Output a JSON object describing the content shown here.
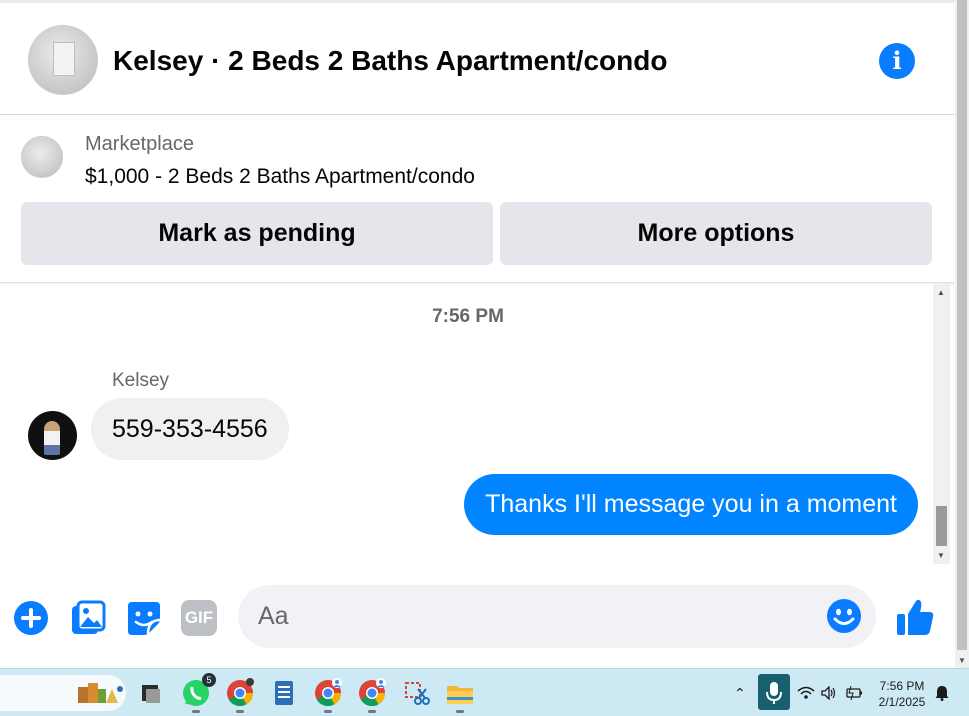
{
  "header": {
    "title": "Kelsey · 2 Beds 2 Baths Apartment/condo",
    "info_icon_glyph": "i"
  },
  "listing": {
    "source": "Marketplace",
    "name": "$1,000 - 2 Beds 2 Baths Apartment/condo",
    "primary_button": "Mark as pending",
    "secondary_button": "More options"
  },
  "conversation": {
    "timestamp": "7:56 PM",
    "messages": [
      {
        "sender": "Kelsey",
        "text": "559-353-4556",
        "direction": "incoming"
      },
      {
        "sender": "me",
        "text": "Thanks I'll message you in a moment",
        "direction": "outgoing"
      }
    ]
  },
  "composer": {
    "placeholder": "Aa",
    "value": "",
    "gif_label": "GIF",
    "icons": [
      "plus-icon",
      "photo-icon",
      "sticker-icon",
      "gif-icon",
      "emoji-icon",
      "thumbs-up-icon"
    ]
  },
  "taskbar": {
    "apps": [
      "widgets-icon",
      "app-icon",
      "whatsapp-icon",
      "chrome-icon",
      "notepad-icon",
      "chrome-profile-icon",
      "chrome-profile-icon",
      "snipping-tool-icon",
      "file-explorer-icon"
    ],
    "whatsapp_badge": "5",
    "time": "7:56 PM",
    "date": "2/1/2025"
  },
  "colors": {
    "messenger_blue": "#0084ff",
    "icon_blue": "#0a7cff",
    "bubble_gray": "#f0f0f0",
    "button_gray": "#e4e6eb",
    "taskbar": "#cdeaf4"
  }
}
